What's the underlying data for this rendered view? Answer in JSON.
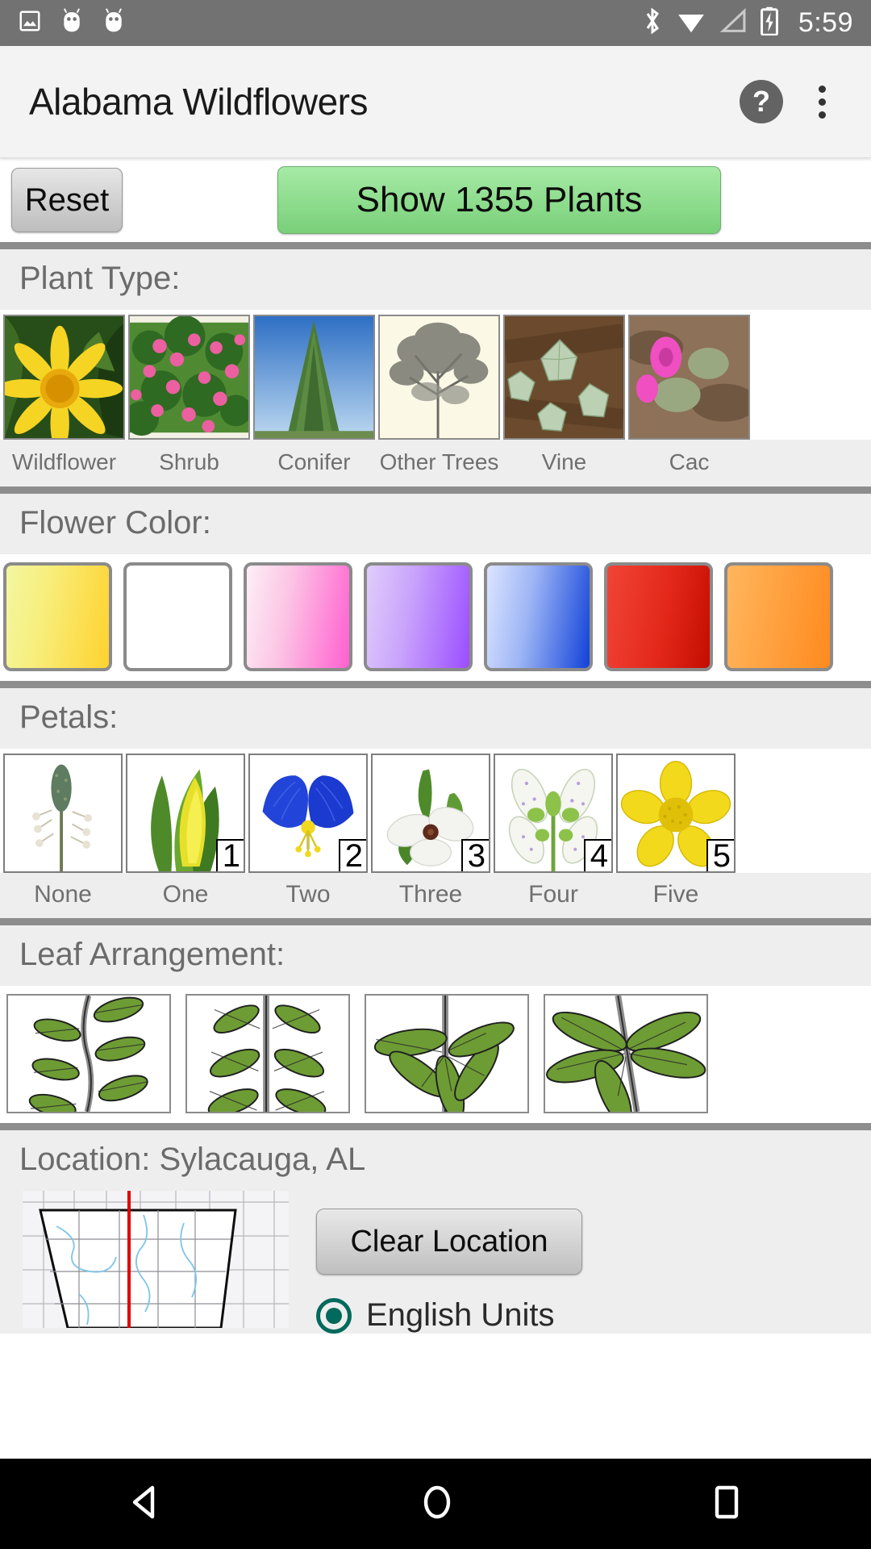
{
  "status_bar": {
    "time": "5:59",
    "left_icons": [
      "image-icon",
      "android-icon",
      "android-icon"
    ],
    "right_icons": [
      "bluetooth-icon",
      "wifi-icon",
      "signal-icon",
      "battery-charging-icon"
    ],
    "background": "#727272"
  },
  "app_bar": {
    "title": "Alabama Wildflowers",
    "help_label": "?",
    "help_icon": "help-circle-icon",
    "overflow_icon": "more-vertical-icon",
    "background": "#f3f3f3"
  },
  "actions": {
    "reset_label": "Reset",
    "show_label": "Show 1355 Plants",
    "plant_count": 1355,
    "show_color": "#8ddc8d"
  },
  "sections": {
    "plant_type": {
      "header": "Plant Type:",
      "items": [
        {
          "label": "Wildflower",
          "thumb": "yellow-sunflower-photo"
        },
        {
          "label": "Shrub",
          "thumb": "pink-flowering-shrub-photo"
        },
        {
          "label": "Conifer",
          "thumb": "conifer-tree-sky-photo"
        },
        {
          "label": "Other Trees",
          "thumb": "bare-tree-sepia-photo"
        },
        {
          "label": "Vine",
          "thumb": "ivy-vine-leaves-photo"
        },
        {
          "label": "Cac",
          "thumb": "cactus-pink-bloom-photo"
        }
      ]
    },
    "flower_color": {
      "header": "Flower Color:",
      "items": [
        {
          "name": "Yellow",
          "from": "#f2f7a1",
          "to": "#ffd22e"
        },
        {
          "name": "White",
          "from": "#ffffff",
          "to": "#ffffff"
        },
        {
          "name": "Pink",
          "from": "#fdeff6",
          "to": "#ff5fd0"
        },
        {
          "name": "Purple",
          "from": "#e0cdfb",
          "to": "#9b4dff"
        },
        {
          "name": "Blue",
          "from": "#dbe5ff",
          "to": "#1142d8"
        },
        {
          "name": "Red",
          "from": "#f04536",
          "to": "#c40d00"
        }
      ]
    },
    "petals": {
      "header": "Petals:",
      "items": [
        {
          "label": "None",
          "badge": "",
          "thumb": "plantain-spike-photo"
        },
        {
          "label": "One",
          "badge": "1",
          "thumb": "yellow-spathe-photo"
        },
        {
          "label": "Two",
          "badge": "2",
          "thumb": "blue-dayflower-photo"
        },
        {
          "label": "Three",
          "badge": "3",
          "thumb": "white-trillium-photo"
        },
        {
          "label": "Four",
          "badge": "4",
          "thumb": "white-spotted-flower-photo"
        },
        {
          "label": "Five",
          "badge": "5",
          "thumb": "yellow-buttercup-photo"
        }
      ]
    },
    "leaf_arrangement": {
      "header": "Leaf Arrangement:",
      "items": [
        {
          "name": "alternate-leaves-diagram"
        },
        {
          "name": "opposite-leaves-diagram"
        },
        {
          "name": "whorled-leaves-diagram"
        },
        {
          "name": "palmate-leaves-diagram"
        }
      ]
    },
    "location": {
      "header": "Location: Sylacauga, AL",
      "city": "Sylacauga",
      "state": "AL",
      "clear_label": "Clear Location",
      "map_name": "alabama-county-map",
      "units_label": "English Units",
      "units_selected": true
    }
  },
  "nav_bar": {
    "back": "back-triangle-icon",
    "home": "home-circle-icon",
    "recents": "recents-square-icon"
  }
}
